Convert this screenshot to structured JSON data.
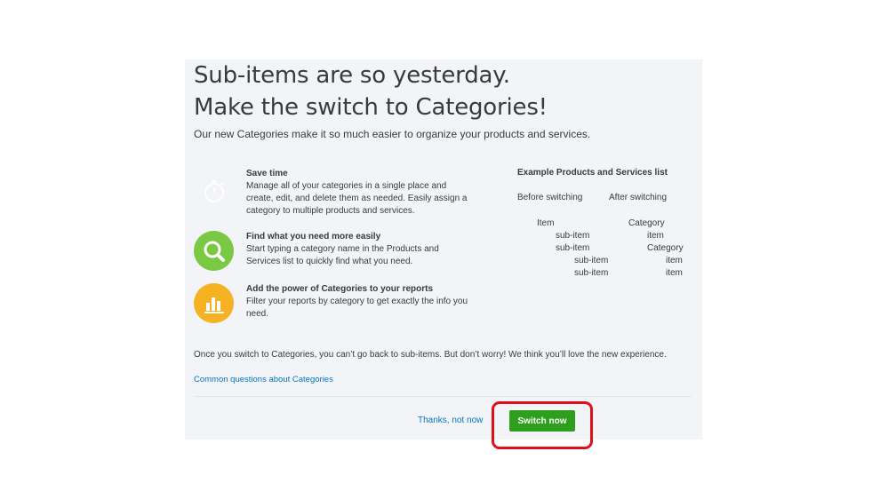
{
  "dialog": {
    "title_line1": "Sub-items are so yesterday.",
    "title_line2": "Make the switch to Categories!",
    "subtitle": "Our new Categories make it so much easier to organize your products and services."
  },
  "features": [
    {
      "icon": "stopwatch-icon",
      "heading": "Save time",
      "body": "Manage all of your categories in a single place and create, edit, and delete them as needed. Easily assign a category to multiple products and services.",
      "color": "#ffffff"
    },
    {
      "icon": "magnifier-icon",
      "heading": "Find what you need more easily",
      "body": "Start typing a category name in the Products and Services list to quickly find what you need.",
      "color": "#7ac943"
    },
    {
      "icon": "bar-chart-icon",
      "heading": "Add the power of Categories to your reports",
      "body": "Filter your reports by category to get exactly the info you need.",
      "color": "#f5b324"
    }
  ],
  "example": {
    "heading": "Example Products and Services list",
    "before_label": "Before switching",
    "after_label": "After switching",
    "before_rows": [
      "Item",
      "sub-item",
      "sub-item",
      "sub-item",
      "sub-item"
    ],
    "after_rows": [
      "Category",
      "item",
      "Category",
      "item",
      "item"
    ]
  },
  "note": "Once you switch to Categories, you can’t go back to sub-items. But don’t worry! We think you’ll love the new experience.",
  "link": "Common questions about Categories",
  "actions": {
    "cancel": "Thanks, not now",
    "primary": "Switch now"
  },
  "colors": {
    "primary": "#2ca01c",
    "link": "#0077c5",
    "highlight": "#e0101a"
  }
}
